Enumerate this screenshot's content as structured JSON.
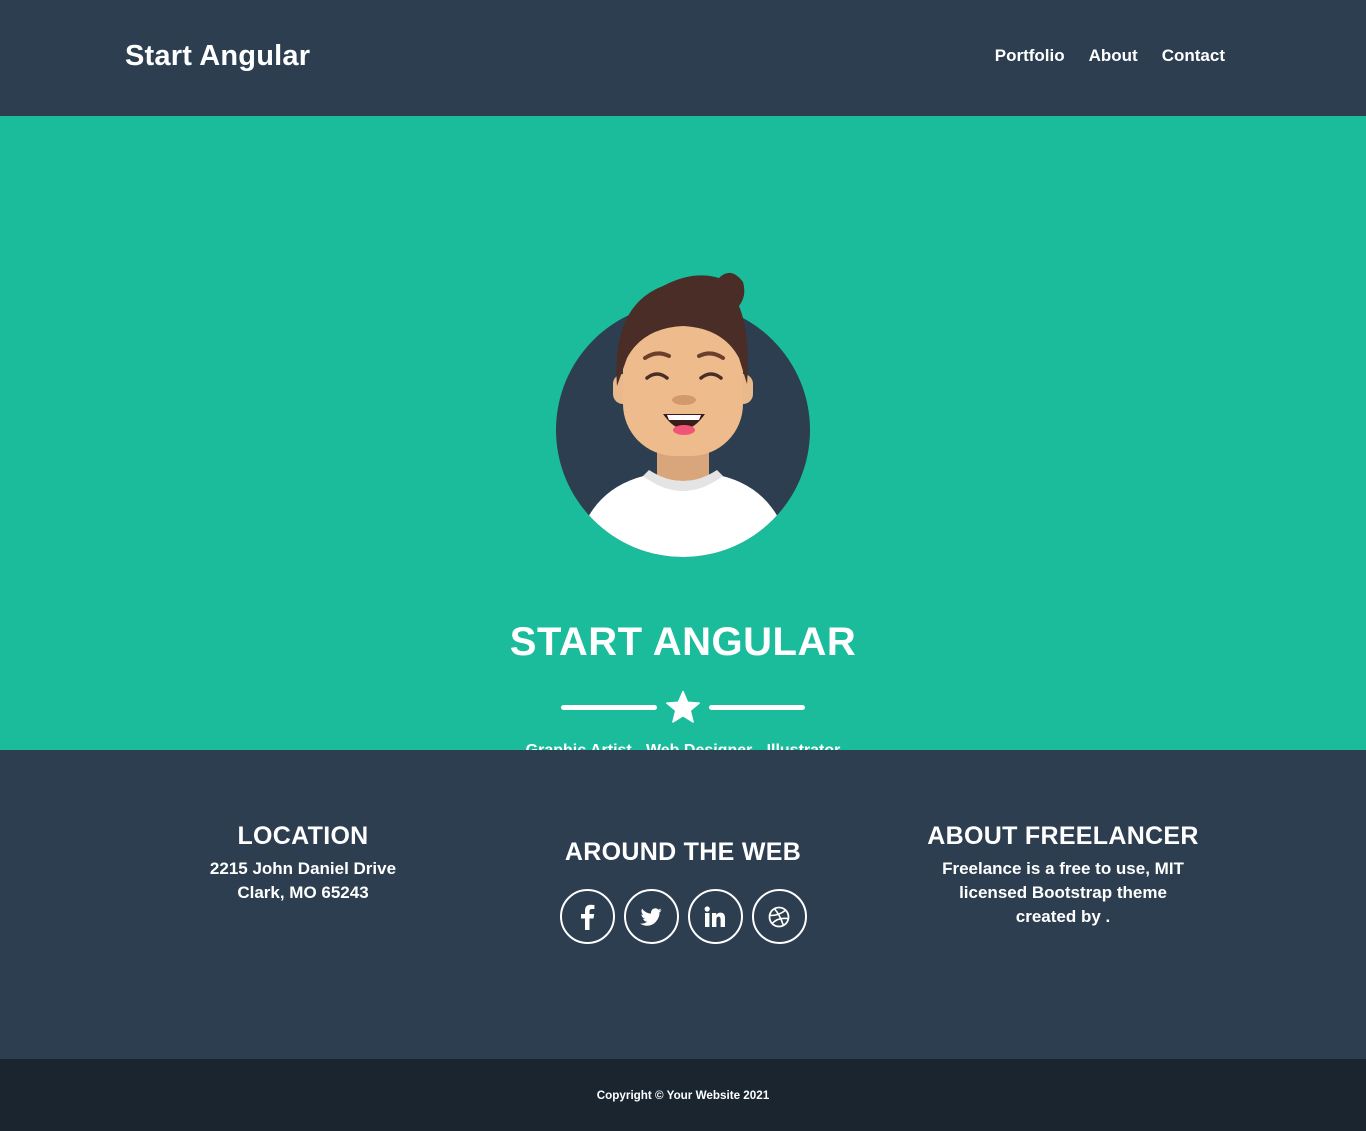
{
  "nav": {
    "brand": "Start Angular",
    "links": [
      "Portfolio",
      "About",
      "Contact"
    ]
  },
  "masthead": {
    "title": "START ANGULAR",
    "subtitle": "Graphic Artist - Web Designer - Illustrator",
    "divider_icon": "star-icon"
  },
  "footer": {
    "location": {
      "heading": "LOCATION",
      "line1": "2215 John Daniel Drive",
      "line2": "Clark, MO 65243"
    },
    "web": {
      "heading": "AROUND THE WEB",
      "icons": [
        "facebook-icon",
        "twitter-icon",
        "linkedin-icon",
        "dribbble-icon"
      ]
    },
    "about": {
      "heading": "ABOUT FREELANCER",
      "text": "Freelance is a free to use, MIT licensed Bootstrap theme created by ."
    }
  },
  "copyright": "Copyright © Your Website 2021",
  "colors": {
    "primary": "#2c3e50",
    "accent": "#1abc9c",
    "dark": "#1a252f"
  }
}
